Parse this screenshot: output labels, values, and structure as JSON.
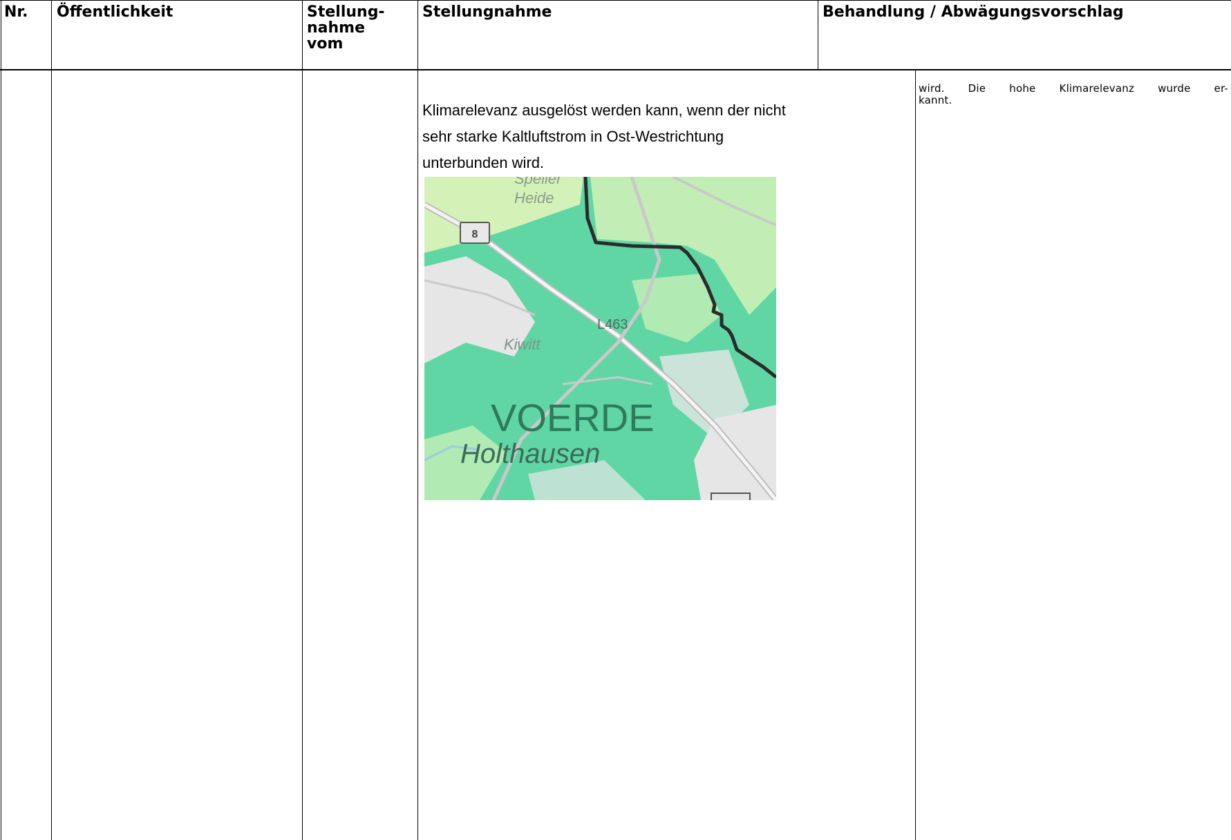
{
  "header": {
    "nr": "Nr.",
    "oeffentlichkeit": "Öffentlichkeit",
    "stellungnahme_vom_line1": "Stellung-",
    "stellungnahme_vom_line2": "nahme",
    "stellungnahme_vom_line3": "vom",
    "stellungnahme": "Stellungnahme",
    "behandlung": "Behandlung / Abwägungsvorschlag"
  },
  "content": {
    "stellungnahme_lines": [
      "Klimarelevanz ausgelöst werden kann, wenn der nicht",
      "sehr starke Kaltluftstrom in Ost-Westrichtung",
      "unterbunden wird."
    ],
    "behandlung_line1": "wird. Die hohe Klimarelevanz wurde er-",
    "behandlung_line2": "kannt."
  },
  "map": {
    "labels": {
      "heide_top": "Speller",
      "heide": "Heide",
      "road_b": "8",
      "road_l": "L463",
      "kiwitt": "Kiwitt",
      "city": "VOERDE",
      "district": "Holthausen"
    },
    "colors": {
      "forest": "#5fd6a4",
      "meadow": "#d4f2b8",
      "built": "#e6e6e6",
      "boundary": "#2b2b2b"
    }
  }
}
